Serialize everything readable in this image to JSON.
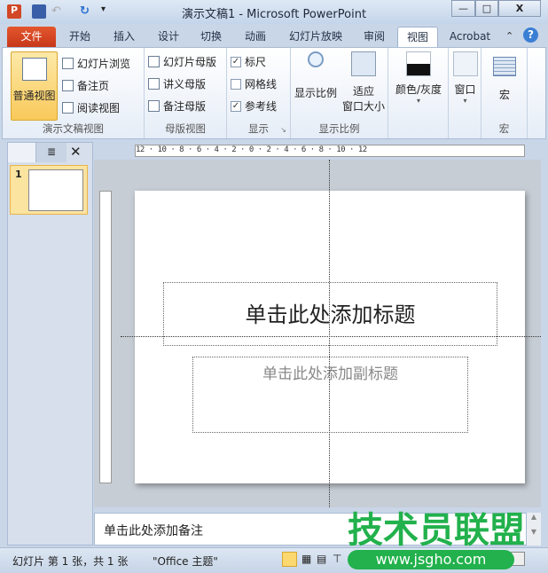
{
  "window": {
    "title": "演示文稿1 - Microsoft PowerPoint",
    "minimize": "—",
    "maximize": "□",
    "close": "X"
  },
  "tabs": [
    "文件",
    "开始",
    "插入",
    "设计",
    "切换",
    "动画",
    "幻灯片放映",
    "审阅",
    "视图",
    "Acrobat"
  ],
  "active_tab": "视图",
  "ribbon": {
    "presentation_views": {
      "label": "演示文稿视图",
      "normal": "普通视图",
      "sorter": "幻灯片浏览",
      "notes_page": "备注页",
      "reading": "阅读视图"
    },
    "master_views": {
      "label": "母版视图",
      "slide_master": "幻灯片母版",
      "handout_master": "讲义母版",
      "notes_master": "备注母版"
    },
    "show": {
      "label": "显示",
      "ruler": "标尺",
      "ruler_checked": true,
      "gridlines": "网格线",
      "gridlines_checked": false,
      "guides": "参考线",
      "guides_checked": true
    },
    "zoom": {
      "label": "显示比例",
      "zoom": "显示比例",
      "fit1": "适应",
      "fit2": "窗口大小"
    },
    "color": {
      "label": "颜色/灰度"
    },
    "window": {
      "label": "窗口"
    },
    "macros": {
      "label": "宏",
      "group": "宏"
    }
  },
  "left_panel": {
    "slide_number": "1"
  },
  "ruler_text": "12 · 10 · 8 · 6 · 4 · 2 · 0 · 2 · 4 · 6 · 8 · 10 · 12",
  "slide": {
    "title_placeholder": "单击此处添加标题",
    "subtitle_placeholder": "单击此处添加副标题"
  },
  "notes": {
    "placeholder": "单击此处添加备注"
  },
  "status": {
    "slide_info": "幻灯片 第 1 张，共 1 张",
    "theme": "\"Office 主题\""
  },
  "watermark": {
    "text": "技术员联盟",
    "url": "www.jsgho.com"
  }
}
